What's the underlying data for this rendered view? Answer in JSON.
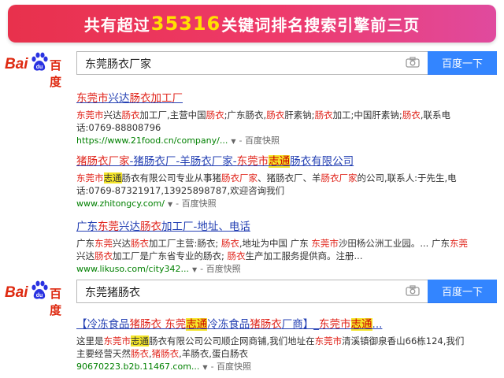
{
  "banner": {
    "pre": "共有超过",
    "num": "35316",
    "post": "关键词排名搜索引擎前三页"
  },
  "search1": {
    "logo_bai": "Bai",
    "logo_du": "百度",
    "query": "东莞肠衣厂家",
    "button": "百度一下"
  },
  "search2": {
    "logo_bai": "Bai",
    "logo_du": "百度",
    "query": "东莞猪肠衣",
    "button": "百度一下"
  },
  "results1": [
    {
      "title": [
        [
          "东莞市",
          "r"
        ],
        [
          "兴达",
          "b"
        ],
        [
          "肠衣",
          "r"
        ],
        [
          "加工厂",
          "r"
        ]
      ],
      "desc": [
        [
          "东莞市",
          "r"
        ],
        [
          "兴达",
          "n"
        ],
        [
          "肠衣",
          "r"
        ],
        [
          "加工厂,主营中国",
          "n"
        ],
        [
          "肠衣",
          "r"
        ],
        [
          ";广东肠衣,",
          "n"
        ],
        [
          "肠衣",
          "r"
        ],
        [
          "肝素钠;",
          "n"
        ],
        [
          "肠衣",
          "r"
        ],
        [
          "加工;中国肝素钠;",
          "n"
        ],
        [
          "肠衣",
          "r"
        ],
        [
          ",联系电话:0769-88808796",
          "n"
        ]
      ],
      "url": "https://www.21food.cn/company/...",
      "kuaizhao": "百度快照"
    },
    {
      "title": [
        [
          "猪肠衣厂家",
          "r"
        ],
        [
          "-猪肠衣厂-羊肠衣厂家-",
          "b"
        ],
        [
          "东莞市",
          "r"
        ],
        [
          "志通",
          "h"
        ],
        [
          "肠衣有限公司",
          "b"
        ]
      ],
      "desc": [
        [
          "东莞市",
          "r"
        ],
        [
          "志通",
          "h"
        ],
        [
          "肠衣有限公司专业从事猪",
          "n"
        ],
        [
          "肠衣厂家",
          "r"
        ],
        [
          "、猪肠衣厂、羊",
          "n"
        ],
        [
          "肠衣厂家",
          "r"
        ],
        [
          "的公司,联系人:于先生,电话:0769-87321917,13925898787,欢迎咨询我们",
          "n"
        ]
      ],
      "url": "www.zhitongcy.com/",
      "kuaizhao": "百度快照"
    },
    {
      "title": [
        [
          "广东",
          "b"
        ],
        [
          "东莞",
          "r"
        ],
        [
          "兴达",
          "b"
        ],
        [
          "肠衣",
          "r"
        ],
        [
          "加工厂-地址、电话",
          "b"
        ]
      ],
      "desc": [
        [
          "广东",
          "n"
        ],
        [
          "东莞",
          "r"
        ],
        [
          "兴达",
          "n"
        ],
        [
          "肠衣",
          "r"
        ],
        [
          "加工厂主营:肠衣; ",
          "n"
        ],
        [
          "肠衣",
          "r"
        ],
        [
          ",地址为中国 广东 ",
          "n"
        ],
        [
          "东莞市",
          "r"
        ],
        [
          "沙田杨公洲工业园。... 广东",
          "n"
        ],
        [
          "东莞",
          "r"
        ],
        [
          "兴达",
          "n"
        ],
        [
          "肠衣",
          "r"
        ],
        [
          "加工厂是广东省专业的肠衣; ",
          "n"
        ],
        [
          "肠衣",
          "r"
        ],
        [
          "生产加工服务提供商。注册...",
          "n"
        ]
      ],
      "url": "www.likuso.com/city342...",
      "kuaizhao": "百度快照"
    }
  ],
  "results2": [
    {
      "title": [
        [
          "【冷冻食品",
          "b"
        ],
        [
          "猪肠衣",
          "r"
        ],
        [
          " ",
          "b"
        ],
        [
          "东莞",
          "r"
        ],
        [
          "志通",
          "h"
        ],
        [
          "冷冻食品",
          "b"
        ],
        [
          "猪肠衣",
          "r"
        ],
        [
          "厂商】_",
          "b"
        ],
        [
          "东莞市",
          "r"
        ],
        [
          "志通",
          "h"
        ],
        [
          "...",
          "b"
        ]
      ],
      "desc": [
        [
          "这里是",
          "n"
        ],
        [
          "东莞市",
          "r"
        ],
        [
          "志通",
          "h"
        ],
        [
          "肠衣有限公司公司顺企网商铺,我们地址在",
          "n"
        ],
        [
          "东莞市",
          "r"
        ],
        [
          "清溪镇御泉香山66栋124,我们主要经营天然",
          "n"
        ],
        [
          "肠衣",
          "r"
        ],
        [
          ",",
          "n"
        ],
        [
          "猪肠衣",
          "r"
        ],
        [
          ",羊肠衣,蛋白肠衣",
          "n"
        ]
      ],
      "url": "90670223.b2b.11467.com...",
      "kuaizhao": "百度快照"
    }
  ],
  "colors": {
    "title_blue": "#2440b3",
    "keyword_red": "#e0251c",
    "url_green": "#008000",
    "button_blue": "#3385ff",
    "highlight_yellow": "#f5e62a"
  }
}
